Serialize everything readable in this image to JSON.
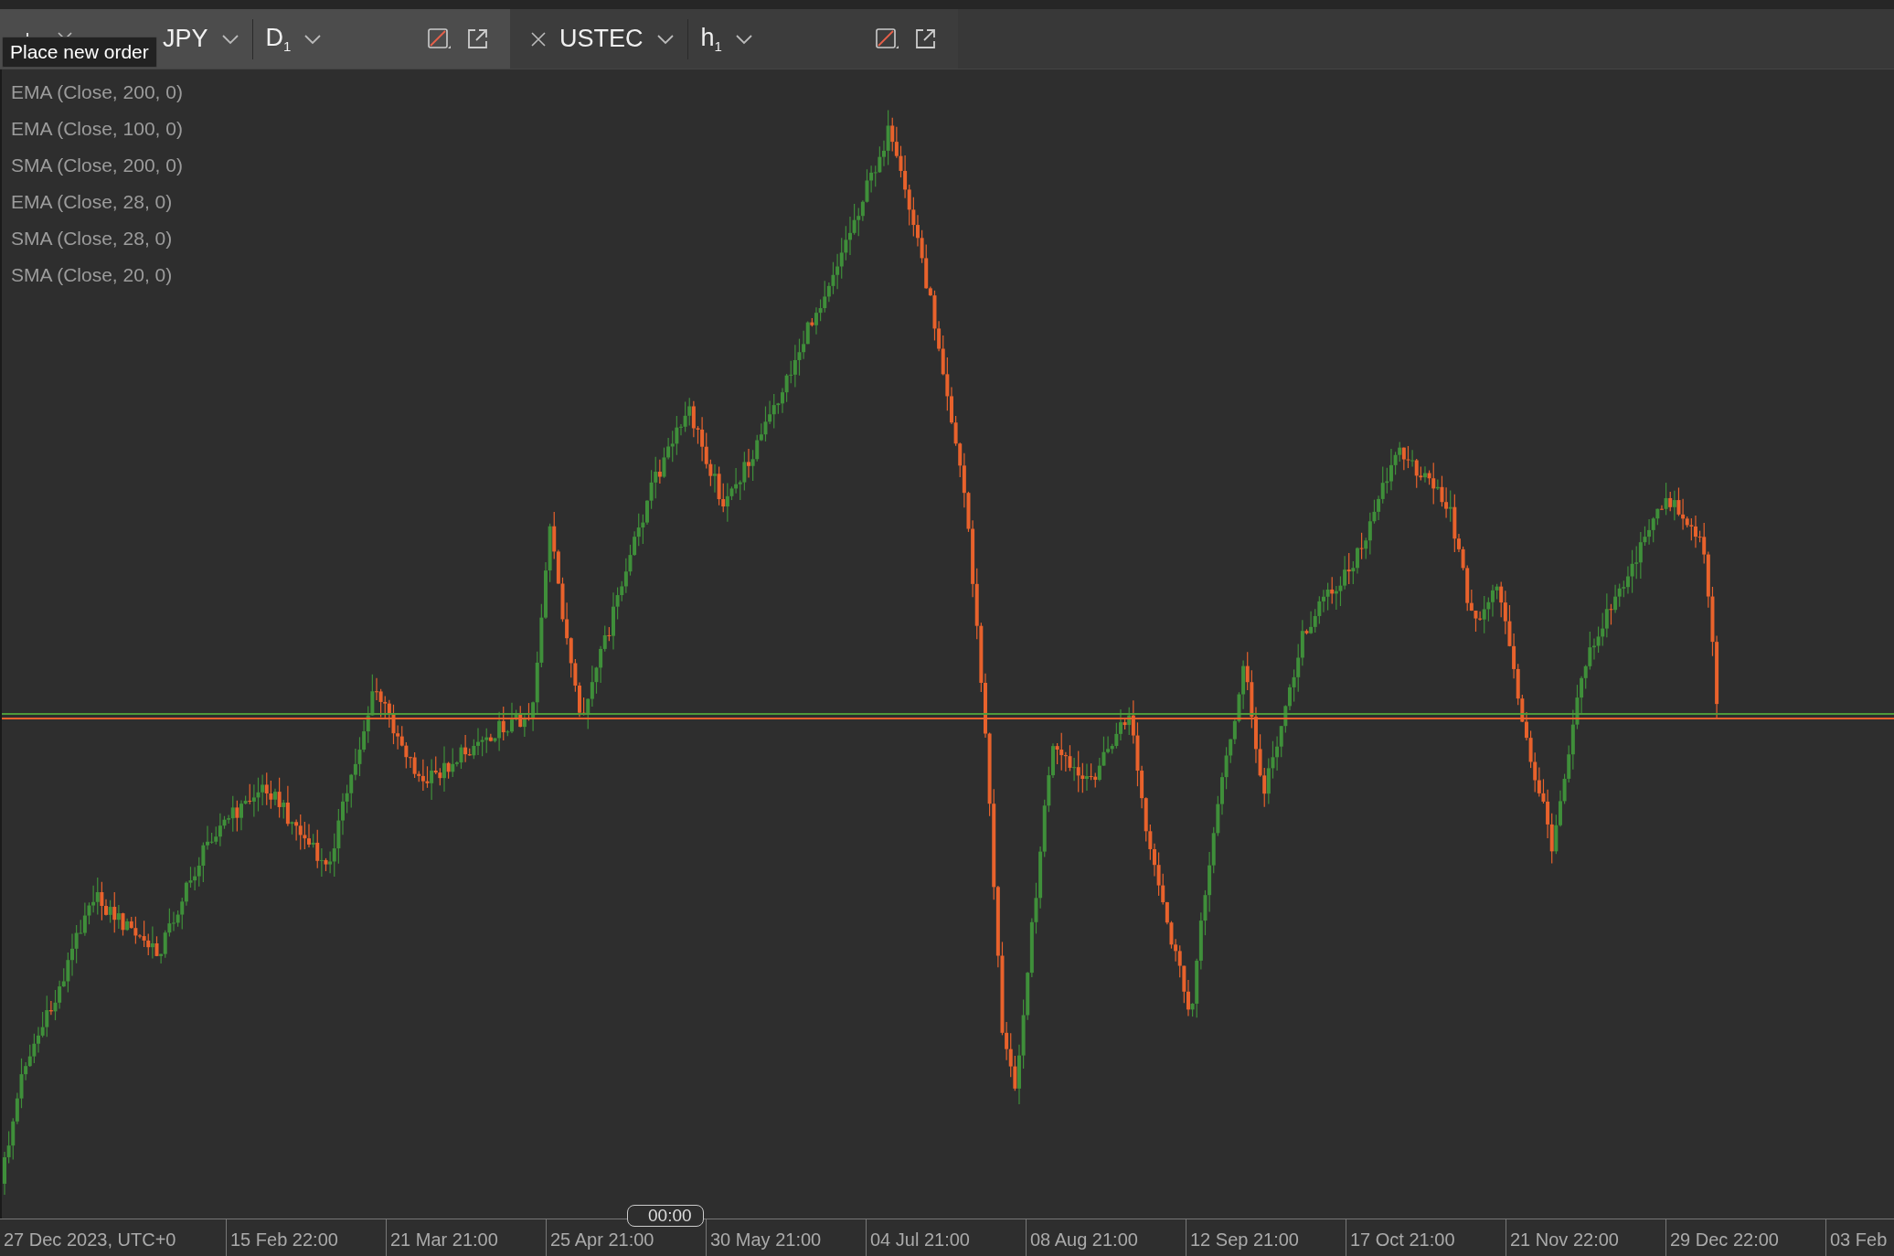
{
  "tabs": [
    {
      "symbol": "JPY",
      "timeframe": "D",
      "timeframe_index": "1",
      "selected": true
    },
    {
      "symbol": "USTEC",
      "timeframe": "h",
      "timeframe_index": "1",
      "selected": false
    }
  ],
  "tooltip": "Place new order",
  "indicators": [
    "EMA (Close, 200, 0)",
    "EMA (Close, 100, 0)",
    "SMA (Close, 200, 0)",
    "EMA (Close, 28, 0)",
    "SMA (Close, 28, 0)",
    "SMA (Close, 20, 0)"
  ],
  "time_axis": {
    "labels": [
      "27 Dec 2023, UTC+0",
      "15 Feb 22:00",
      "21 Mar 21:00",
      "25 Apr 21:00",
      "30 May 21:00",
      "04 Jul 21:00",
      "08 Aug 21:00",
      "12 Sep 21:00",
      "17 Oct 21:00",
      "21 Nov 22:00",
      "29 Dec 22:00",
      "03 Feb"
    ],
    "cursor_time": "00:00"
  }
}
